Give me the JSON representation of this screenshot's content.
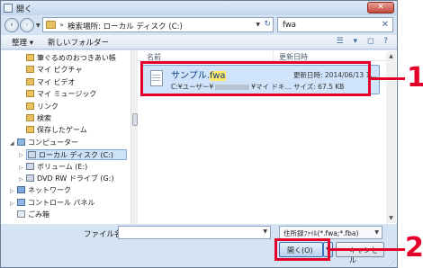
{
  "window": {
    "title": "開く",
    "close_label": "✕"
  },
  "address": {
    "back_icon": "‹",
    "forward_icon": "›",
    "path_separator": "»",
    "path": "検索場所: ローカル ディスク (C:)",
    "refresh_icon": "↻"
  },
  "search": {
    "value": "fwa",
    "icon": "✕"
  },
  "toolbar": {
    "organize_label": "整理 ▾",
    "new_folder_label": "新しいフォルダー",
    "view_icons": "☰ ▾ ◻ ?"
  },
  "tree": {
    "items": [
      {
        "label": "筆ぐるめのおつきあい帳",
        "icon": "folder"
      },
      {
        "label": "マイ ピクチャ",
        "icon": "folder"
      },
      {
        "label": "マイ ビデオ",
        "icon": "folder"
      },
      {
        "label": "マイ ミュージック",
        "icon": "folder"
      },
      {
        "label": "リンク",
        "icon": "folder"
      },
      {
        "label": "検索",
        "icon": "folder"
      },
      {
        "label": "保存したゲーム",
        "icon": "folder"
      },
      {
        "label": "コンピューター",
        "icon": "pc"
      },
      {
        "label": "ローカル ディスク (C:)",
        "icon": "drive"
      },
      {
        "label": "ボリューム (E:)",
        "icon": "drive"
      },
      {
        "label": "DVD RW ドライブ (G:)",
        "icon": "drive"
      },
      {
        "label": "ネットワーク",
        "icon": "net"
      },
      {
        "label": "コントロール パネル",
        "icon": "pc"
      },
      {
        "label": "ごみ箱",
        "icon": "trash"
      }
    ]
  },
  "files": {
    "columns": {
      "name": "名前",
      "date": "更新日時"
    },
    "item": {
      "name_prefix": "サンプル.",
      "name_highlight": "fwa",
      "path_start": "C:¥ユーザー¥",
      "path_end": "¥マイ ドキ...",
      "date": "更新日時: 2014/06/13 1...",
      "size": "サイズ: 67.5 KB"
    }
  },
  "bottom": {
    "filename_label": "ファイル名(",
    "filename_key": "N",
    "filename_label_end": "):",
    "filename_value": "",
    "filter": "住所録ﾌｧｲﾙ(*.fwa;*.fba)",
    "open_label": "開く(O)",
    "cancel_label": "キャンセル"
  },
  "callouts": {
    "one": "1",
    "two": "2",
    "color": "#e5002a"
  }
}
